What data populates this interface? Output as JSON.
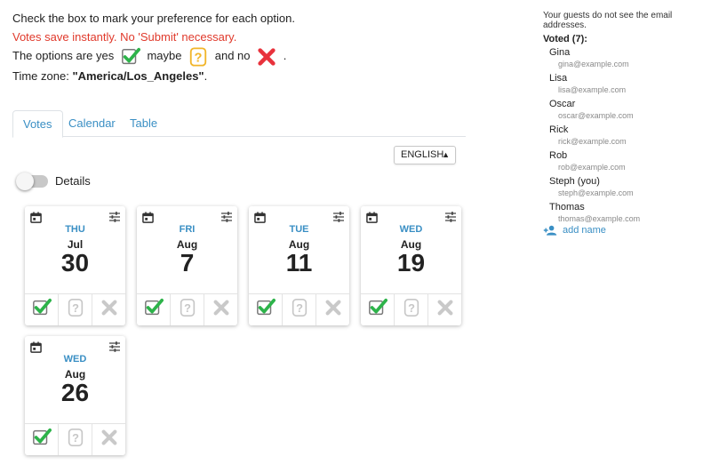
{
  "instructions": {
    "line1": "Check the box to mark your preference for each option.",
    "line2": "Votes save instantly. No 'Submit' necessary.",
    "options_prefix": "The options are",
    "yes_label": "yes",
    "maybe_label": "maybe",
    "no_label": "and no",
    "options_suffix": ".",
    "tz_prefix": "Time zone: ",
    "tz_value": "\"America/Los_Angeles\"",
    "tz_suffix": "."
  },
  "tabs": [
    {
      "label": "Votes",
      "active": true
    },
    {
      "label": "Calendar",
      "active": false
    },
    {
      "label": "Table",
      "active": false
    }
  ],
  "language": {
    "value": "ENGLISH"
  },
  "details": {
    "label": "Details",
    "on": false
  },
  "options": [
    {
      "dow": "THU",
      "month": "Jul",
      "day": "30",
      "vote": "yes"
    },
    {
      "dow": "FRI",
      "month": "Aug",
      "day": "7",
      "vote": "yes"
    },
    {
      "dow": "TUE",
      "month": "Aug",
      "day": "11",
      "vote": "yes"
    },
    {
      "dow": "WED",
      "month": "Aug",
      "day": "19",
      "vote": "yes"
    },
    {
      "dow": "WED",
      "month": "Aug",
      "day": "26",
      "vote": "yes"
    }
  ],
  "sidebar": {
    "note": "Your guests do not see the email addresses.",
    "voted_heading": "Voted (7):",
    "guests": [
      {
        "name": "Gina",
        "email": "gina@example.com"
      },
      {
        "name": "Lisa",
        "email": "lisa@example.com"
      },
      {
        "name": "Oscar",
        "email": "oscar@example.com"
      },
      {
        "name": "Rick",
        "email": "rick@example.com"
      },
      {
        "name": "Rob",
        "email": "rob@example.com"
      },
      {
        "name": "Steph (you)",
        "email": "steph@example.com"
      },
      {
        "name": "Thomas",
        "email": "thomas@example.com"
      }
    ],
    "add_name_label": "add name"
  },
  "colors": {
    "accent": "#3a8fc4",
    "warning": "#e0392b",
    "yes": "#2db34a",
    "no": "#e8323c",
    "maybe": "#f1b52a"
  }
}
